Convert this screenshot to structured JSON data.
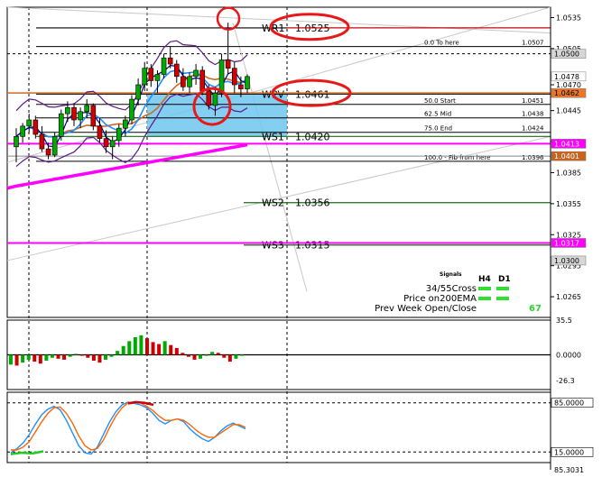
{
  "chart_data": [
    {
      "type": "candlestick",
      "panel": "price",
      "y_range": [
        1.0245,
        1.0545
      ],
      "y_ticks": [
        "1.0535",
        "1.0505",
        "1.0470",
        "1.0445",
        "1.0415",
        "1.0385",
        "1.0355",
        "1.0325",
        "1.0295",
        "1.0265"
      ],
      "candles": [
        [
          1.041,
          1.0428,
          1.0395,
          1.042
        ],
        [
          1.042,
          1.0433,
          1.0414,
          1.043
        ],
        [
          1.043,
          1.0442,
          1.0424,
          1.0436
        ],
        [
          1.0436,
          1.044,
          1.0418,
          1.0422
        ],
        [
          1.0422,
          1.043,
          1.0405,
          1.0408
        ],
        [
          1.0408,
          1.0414,
          1.0398,
          1.0402
        ],
        [
          1.0402,
          1.0424,
          1.04,
          1.042
        ],
        [
          1.042,
          1.0446,
          1.0416,
          1.0442
        ],
        [
          1.0442,
          1.0454,
          1.0434,
          1.0448
        ],
        [
          1.0448,
          1.0452,
          1.043,
          1.0436
        ],
        [
          1.0436,
          1.0448,
          1.0428,
          1.0444
        ],
        [
          1.0444,
          1.0456,
          1.0438,
          1.045
        ],
        [
          1.045,
          1.0452,
          1.0426,
          1.043
        ],
        [
          1.043,
          1.0438,
          1.0414,
          1.0418
        ],
        [
          1.0418,
          1.0426,
          1.0404,
          1.041
        ],
        [
          1.041,
          1.042,
          1.0398,
          1.0416
        ],
        [
          1.0416,
          1.0432,
          1.041,
          1.0428
        ],
        [
          1.0428,
          1.044,
          1.042,
          1.0436
        ],
        [
          1.0436,
          1.046,
          1.0432,
          1.0456
        ],
        [
          1.0456,
          1.0476,
          1.045,
          1.047
        ],
        [
          1.047,
          1.0492,
          1.0464,
          1.0486
        ],
        [
          1.0486,
          1.049,
          1.0468,
          1.0474
        ],
        [
          1.0474,
          1.0484,
          1.0462,
          1.048
        ],
        [
          1.048,
          1.05,
          1.0476,
          1.0496
        ],
        [
          1.0496,
          1.0507,
          1.0486,
          1.049
        ],
        [
          1.049,
          1.0494,
          1.0472,
          1.0478
        ],
        [
          1.0478,
          1.0486,
          1.0464,
          1.0468
        ],
        [
          1.0468,
          1.0482,
          1.0462,
          1.0478
        ],
        [
          1.0478,
          1.049,
          1.047,
          1.0484
        ],
        [
          1.0484,
          1.0488,
          1.046,
          1.0464
        ],
        [
          1.0464,
          1.047,
          1.0446,
          1.045
        ],
        [
          1.045,
          1.0468,
          1.044,
          1.0462
        ],
        [
          1.0462,
          1.05,
          1.0458,
          1.0494
        ],
        [
          1.0494,
          1.053,
          1.048,
          1.0486
        ],
        [
          1.0486,
          1.0492,
          1.0462,
          1.047
        ],
        [
          1.047,
          1.0478,
          1.0458,
          1.0466
        ],
        [
          1.0466,
          1.048,
          1.0462,
          1.0478
        ]
      ],
      "levels": [
        {
          "label": "WR1",
          "value": "1.0525"
        },
        {
          "label": "WPV",
          "value": "1.0461"
        },
        {
          "label": "WS1",
          "value": "1.0420"
        },
        {
          "label": "WS2",
          "value": "1.0356"
        },
        {
          "label": "WS3",
          "value": "1.0315"
        }
      ],
      "fib": [
        {
          "text": "0.0    To here",
          "value": "1.0507"
        },
        {
          "text": "50.0   Start",
          "value": "1.0451"
        },
        {
          "text": "62.5   Mid",
          "value": "1.0438"
        },
        {
          "text": "75.0   End",
          "value": "1.0424"
        },
        {
          "text": "100.0 - Fib from here",
          "value": "1.0396"
        }
      ],
      "price_tags": [
        {
          "value": "1.0500",
          "color": "#d6d6d6",
          "text_color": "#000000"
        },
        {
          "value": "1.0478",
          "color": "#ffffff",
          "text_color": "#000000"
        },
        {
          "value": "1.0462",
          "color": "#e9762b",
          "text_color": "#000000"
        },
        {
          "value": "1.0413",
          "color": "#ff00ff",
          "text_color": "#ffffff"
        },
        {
          "value": "1.0401",
          "color": "#c8641e",
          "text_color": "#ffffff"
        },
        {
          "value": "1.0317",
          "color": "#ff00ff",
          "text_color": "#ffffff"
        },
        {
          "value": "1.0300",
          "color": "#d6d6d6",
          "text_color": "#000000"
        }
      ],
      "signals": {
        "title": "Signals",
        "h4": "H4",
        "d1": "D1",
        "rows": [
          "34/55Cross",
          "Price on200EMA",
          "Prev Week Open/Close"
        ],
        "value": "67",
        "colors": {
          "on": "#33dd33",
          "value": "#33cc33"
        }
      },
      "colors": {
        "bull": "#00aa00",
        "bear": "#d00000",
        "ema200": "#ff00ff",
        "ema_orange": "#d2691e",
        "ema_blue": "#1e90ff",
        "ema_navy": "#000080",
        "bands": "#5a1a8a",
        "zone": "#6ec6f0",
        "circle": "#e81818"
      }
    },
    {
      "type": "histogram",
      "panel": "momentum",
      "y_range": [
        -35.5,
        35.5
      ],
      "y_ticks": [
        "35.5",
        "0.0000",
        "-26.3"
      ],
      "values": [
        -10,
        -11,
        -8,
        -5,
        -7,
        -9,
        -6,
        -3,
        -4,
        -5,
        -2,
        1,
        -1,
        -3,
        -6,
        -8,
        -5,
        -2,
        4,
        9,
        14,
        18,
        20,
        17,
        13,
        11,
        14,
        10,
        7,
        2,
        -2,
        -5,
        -4,
        -1,
        3,
        2,
        -3,
        -7,
        -4,
        -1
      ]
    },
    {
      "type": "line",
      "panel": "oscillator",
      "y_range": [
        0,
        100
      ],
      "y_ticks": [
        "85.0000",
        "15.0000",
        "85.3031"
      ],
      "series": [
        {
          "color": "#1e90ff",
          "values": [
            14,
            20,
            28,
            40,
            55,
            68,
            76,
            80,
            75,
            60,
            42,
            24,
            14,
            12,
            22,
            40,
            58,
            72,
            82,
            86,
            84,
            82,
            78,
            70,
            60,
            55,
            60,
            62,
            58,
            48,
            40,
            34,
            30,
            36,
            45,
            52,
            56,
            52,
            48
          ]
        },
        {
          "color": "#ff6600",
          "values": [
            18,
            18,
            22,
            30,
            44,
            58,
            70,
            78,
            79,
            70,
            56,
            38,
            24,
            18,
            20,
            32,
            50,
            66,
            78,
            85,
            86,
            85,
            80,
            74,
            66,
            60,
            60,
            62,
            60,
            54,
            46,
            40,
            36,
            36,
            42,
            48,
            54,
            54,
            50
          ]
        }
      ]
    }
  ]
}
